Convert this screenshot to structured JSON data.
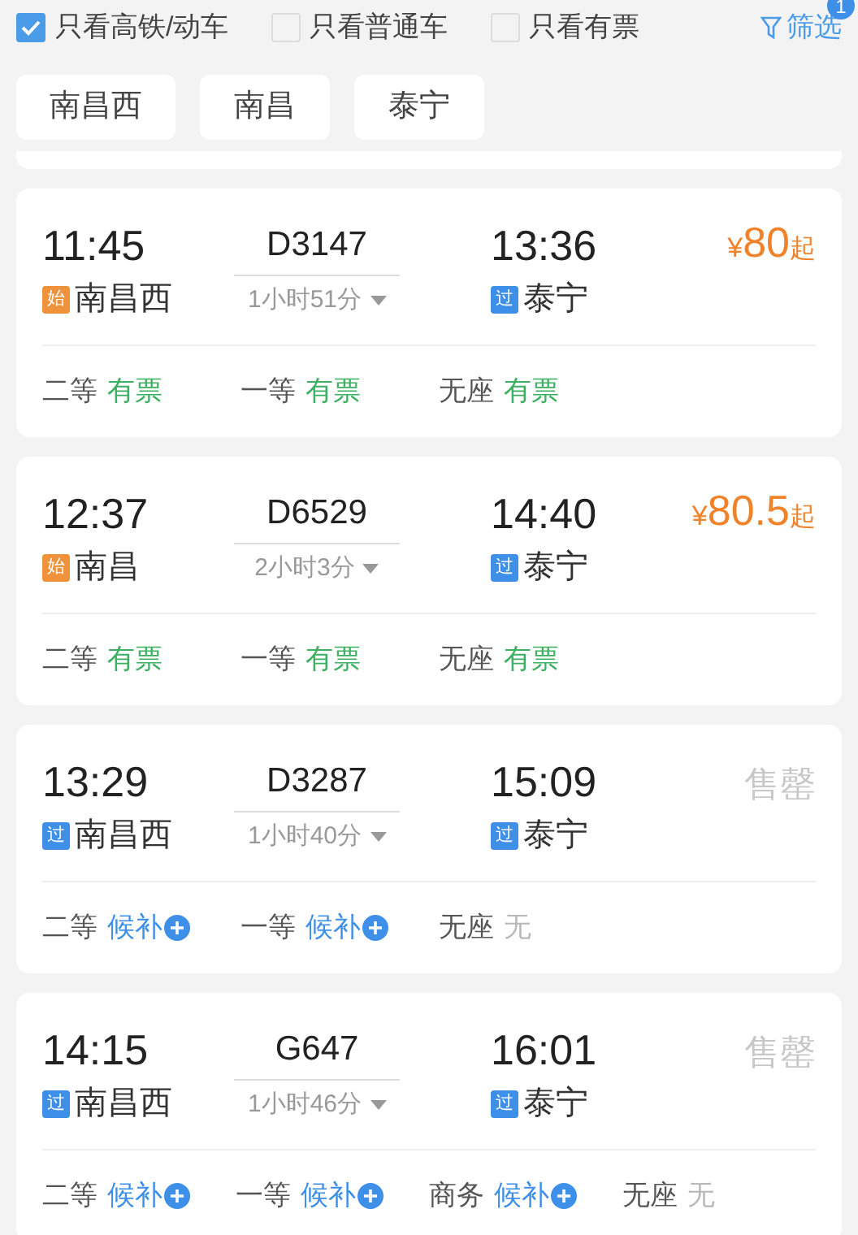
{
  "filters": [
    {
      "label": "只看高铁/动车",
      "checked": true
    },
    {
      "label": "只看普通车",
      "checked": false
    },
    {
      "label": "只看有票",
      "checked": false
    }
  ],
  "filter_button": {
    "label": "筛选",
    "badge": "1"
  },
  "station_chips": [
    "南昌西",
    "南昌",
    "泰宁"
  ],
  "trains": [
    {
      "depart_time": "11:45",
      "depart_station": "南昌西",
      "depart_tag": {
        "kind": "start",
        "text": "始"
      },
      "train_no": "D3147",
      "duration": "1小时51分",
      "arrive_time": "13:36",
      "arrive_station": "泰宁",
      "arrive_tag": {
        "kind": "pass",
        "text": "过"
      },
      "fare": {
        "kind": "price",
        "symbol": "¥",
        "amount": "80",
        "suffix": "起"
      },
      "seats": [
        {
          "class": "二等",
          "kind": "available",
          "status": "有票"
        },
        {
          "class": "一等",
          "kind": "available",
          "status": "有票"
        },
        {
          "class": "无座",
          "kind": "available",
          "status": "有票"
        }
      ]
    },
    {
      "depart_time": "12:37",
      "depart_station": "南昌",
      "depart_tag": {
        "kind": "start",
        "text": "始"
      },
      "train_no": "D6529",
      "duration": "2小时3分",
      "arrive_time": "14:40",
      "arrive_station": "泰宁",
      "arrive_tag": {
        "kind": "pass",
        "text": "过"
      },
      "fare": {
        "kind": "price",
        "symbol": "¥",
        "amount": "80.5",
        "suffix": "起"
      },
      "seats": [
        {
          "class": "二等",
          "kind": "available",
          "status": "有票"
        },
        {
          "class": "一等",
          "kind": "available",
          "status": "有票"
        },
        {
          "class": "无座",
          "kind": "available",
          "status": "有票"
        }
      ]
    },
    {
      "depart_time": "13:29",
      "depart_station": "南昌西",
      "depart_tag": {
        "kind": "pass",
        "text": "过"
      },
      "train_no": "D3287",
      "duration": "1小时40分",
      "arrive_time": "15:09",
      "arrive_station": "泰宁",
      "arrive_tag": {
        "kind": "pass",
        "text": "过"
      },
      "fare": {
        "kind": "sold_out",
        "text": "售罄"
      },
      "seats": [
        {
          "class": "二等",
          "kind": "waitlist",
          "status": "候补"
        },
        {
          "class": "一等",
          "kind": "waitlist",
          "status": "候补"
        },
        {
          "class": "无座",
          "kind": "none",
          "status": "无"
        }
      ]
    },
    {
      "depart_time": "14:15",
      "depart_station": "南昌西",
      "depart_tag": {
        "kind": "pass",
        "text": "过"
      },
      "train_no": "G647",
      "duration": "1小时46分",
      "arrive_time": "16:01",
      "arrive_station": "泰宁",
      "arrive_tag": {
        "kind": "pass",
        "text": "过"
      },
      "fare": {
        "kind": "sold_out",
        "text": "售罄"
      },
      "seats": [
        {
          "class": "二等",
          "kind": "waitlist",
          "status": "候补"
        },
        {
          "class": "一等",
          "kind": "waitlist",
          "status": "候补"
        },
        {
          "class": "商务",
          "kind": "waitlist",
          "status": "候补"
        },
        {
          "class": "无座",
          "kind": "none",
          "status": "无"
        }
      ]
    }
  ]
}
